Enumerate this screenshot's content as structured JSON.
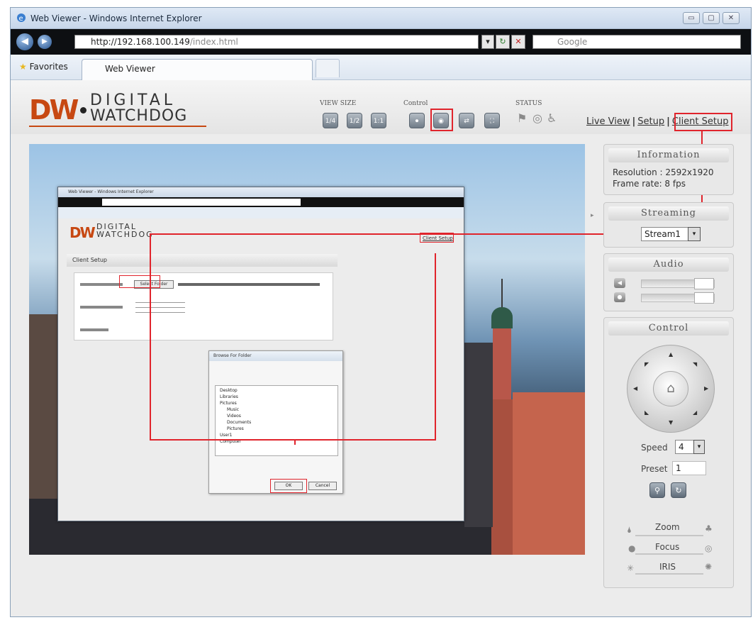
{
  "browser": {
    "title": "Web Viewer - Windows Internet Explorer",
    "url_host": "http://192.168.100.149",
    "url_path": "/index.html",
    "search_placeholder": "Google",
    "favorites_label": "Favorites",
    "tab_label": "Web Viewer"
  },
  "logo": {
    "mark": "DW",
    "line1": "DIGITAL",
    "line2": "WATCHDOG"
  },
  "toolbar": {
    "view_size_label": "VIEW SIZE",
    "control_label": "Control",
    "status_label": "STATUS",
    "view_buttons": [
      "1/4",
      "1/2",
      "1:1"
    ],
    "control_buttons": [
      "rec",
      "snap",
      "ptz",
      "full"
    ]
  },
  "nav": {
    "live_view": "Live View",
    "setup": "Setup",
    "client_setup": "Client Setup",
    "separator": "|"
  },
  "panels": {
    "information": {
      "title": "Information",
      "resolution": "Resolution : 2592x1920",
      "frame_rate": "Frame rate: 8 fps"
    },
    "streaming": {
      "title": "Streaming",
      "selected": "Stream1"
    },
    "audio": {
      "title": "Audio"
    },
    "control": {
      "title": "Control",
      "speed_label": "Speed",
      "speed_value": "4",
      "preset_label": "Preset",
      "preset_value": "1",
      "zoom_label": "Zoom",
      "focus_label": "Focus",
      "iris_label": "IRIS"
    }
  },
  "inner_screenshot": {
    "title": "Web Viewer - Windows Internet Explorer",
    "client_setup_link": "Client Setup",
    "panel_title": "Client Setup",
    "select_folder_button": "Select Folder",
    "dialog_title": "Browse For Folder",
    "dialog_ok": "OK",
    "dialog_cancel": "Cancel",
    "tree_items": [
      "Desktop",
      "Libraries",
      "Pictures",
      "Music",
      "Videos",
      "Documents",
      "Pictures",
      "User1",
      "Computer"
    ]
  },
  "colors": {
    "highlight": "#e0242c",
    "brand": "#c74812"
  },
  "icons": [
    "ie-icon",
    "back-icon",
    "forward-icon",
    "refresh-icon",
    "stop-icon",
    "search-icon",
    "minimize-icon",
    "maximize-icon",
    "close-icon",
    "star-icon",
    "home-icon"
  ]
}
